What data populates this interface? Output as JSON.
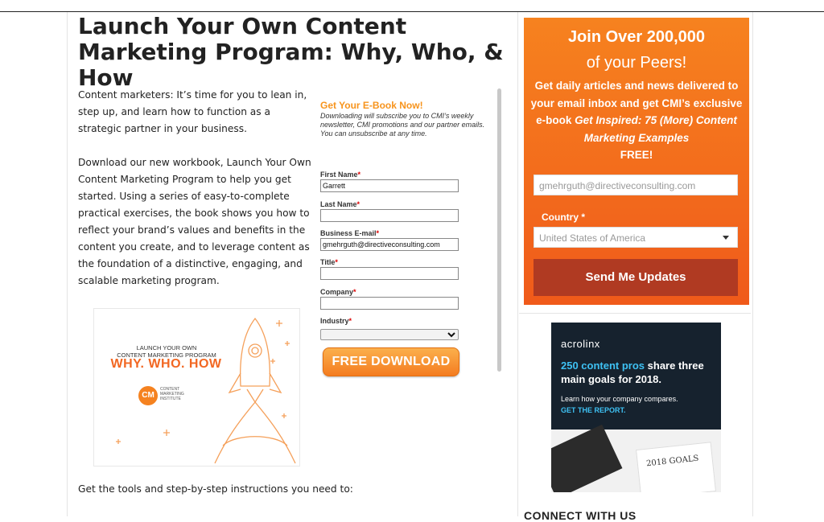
{
  "article": {
    "title": "Launch Your Own Content Marketing Program: Why, Who, & How",
    "para1": "Content marketers: It’s time for you to lean in, step up, and learn how to function as a strategic partner in your business.",
    "para2": "Download our new workbook, Launch Your Own Content Marketing Program to help you get started. Using a series of easy-to-complete practical exercises, the book shows you how to reflect your brand’s values and benefits in the content you create, and to leverage content as the foundation of a distinctive, engaging, and scalable marketing program.",
    "para3": "Get the tools and step-by-step instructions you need to:"
  },
  "book": {
    "line1": "LAUNCH YOUR OWN",
    "line2": "CONTENT MARKETING PROGRAM",
    "line3": "WHY. WHO. HOW",
    "logo": "CM",
    "logo_text": [
      "CONTENT",
      "MARKETING",
      "INSTITUTE"
    ]
  },
  "form": {
    "heading": "Get Your E-Book Now!",
    "subtext": "Downloading will subscribe you to CMI’s weekly newsletter, CMI promotions and our partner emails. You can unsubscribe at any time.",
    "fields": [
      {
        "label": "First Name",
        "value": "Garrett"
      },
      {
        "label": "Last Name",
        "value": ""
      },
      {
        "label": "Business E-mail",
        "value": "gmehrguth@directiveconsulting.com"
      },
      {
        "label": "Title",
        "value": ""
      },
      {
        "label": "Company",
        "value": ""
      },
      {
        "label": "Industry",
        "value": ""
      }
    ],
    "required_mark": "*",
    "button": "FREE DOWNLOAD"
  },
  "promo": {
    "headline1": "Join Over 200,000",
    "headline2": "of your Peers!",
    "body_lead": "Get daily articles and news delivered to your email inbox and get CMI’s exclusive e-book ",
    "body_em": "Get Inspired: 75 (More) Content Marketing Examples",
    "body_tail": "FREE!",
    "email_value": "gmehrguth@directiveconsulting.com",
    "country_label": "Country *",
    "country_value": "United States of America",
    "send_button": "Send Me Updates"
  },
  "ad": {
    "brand": "acrolinx",
    "headline_blue": "250 content pros",
    "headline_rest": " share three main goals for 2018.",
    "sub": "Learn how your company compares.",
    "cta": "GET THE REPORT.",
    "notepad_text": "2018 GOALS"
  },
  "sidebar": {
    "connect_heading": "CONNECT WITH US"
  },
  "colors": {
    "accent_orange": "#f6821f",
    "send_button": "#b03a22",
    "ad_background": "#16222e",
    "ad_highlight": "#3ec1f3"
  }
}
